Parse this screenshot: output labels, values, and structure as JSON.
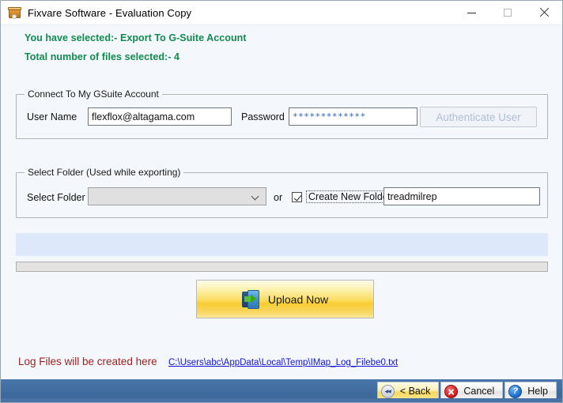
{
  "window": {
    "title": "Fixvare Software - Evaluation Copy",
    "icon": "software-box-icon",
    "controls": {
      "minimize": "minimize-icon",
      "maximize": "maximize-icon",
      "close": "close-icon"
    }
  },
  "banner": {
    "line1": "You have selected:- Export  To G-Suite Account",
    "line2": "Total number of files selected:- 4",
    "color": "#128a50"
  },
  "connect_group": {
    "title": "Connect To My GSuite Account",
    "username_label": "User Name",
    "username_value": "flexflox@altagama.com",
    "username_placeholder": "",
    "password_label": "Password",
    "password_value": "*************",
    "password_placeholder": "",
    "authenticate_button": "Authenticate User"
  },
  "folder_group": {
    "title": "Select Folder (Used while exporting)",
    "select_label": "Select Folder",
    "select_value": "",
    "or_text": "or",
    "create_new_folder_label": "Create New Folder",
    "create_new_folder_checked": true,
    "new_folder_value": "treadmilrep",
    "new_folder_placeholder": ""
  },
  "progress": {
    "status_text": "",
    "percent": 0
  },
  "upload": {
    "label": "Upload Now",
    "icon": "export-arrow-icon"
  },
  "log": {
    "label": "Log Files will be created here",
    "path": "C:\\Users\\abc\\AppData\\Local\\Temp\\IMap_Log_Filebe0.txt",
    "label_color": "#9c1f1f",
    "link_color": "#1414d2"
  },
  "footer": {
    "back_label": "< Back",
    "back_icon": "rewind-icon",
    "cancel_label": "Cancel",
    "cancel_icon": "cancel-circle-icon",
    "help_label": "Help",
    "help_icon": "help-circle-icon",
    "help_glyph": "?"
  }
}
